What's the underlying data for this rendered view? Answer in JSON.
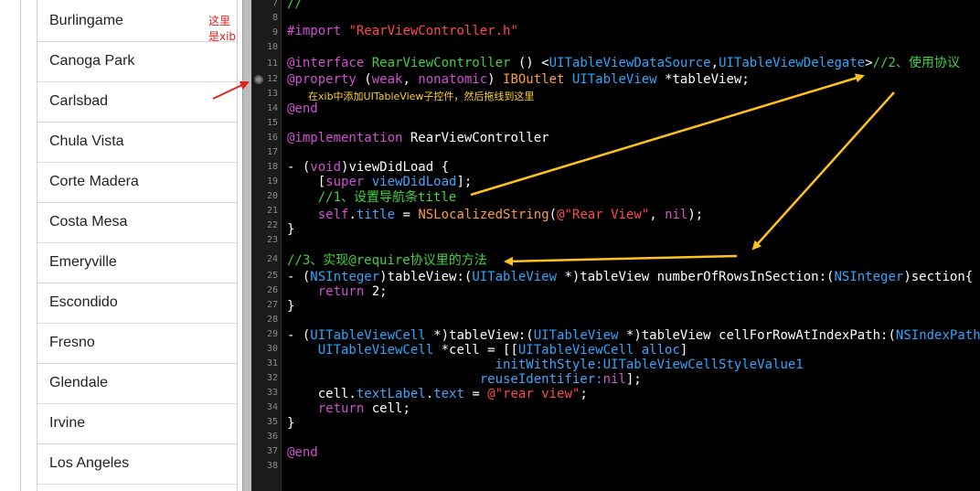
{
  "simulator": {
    "cities": [
      "Burlingame",
      "Canoga Park",
      "Carlsbad",
      "Chula Vista",
      "Corte Madera",
      "Costa Mesa",
      "Emeryville",
      "Escondido",
      "Fresno",
      "Glendale",
      "Irvine",
      "Los Angeles"
    ],
    "xib_note": "这里是xib"
  },
  "editor": {
    "line_numbers": [
      "7",
      "8",
      "9",
      "10",
      "11",
      "12",
      "13",
      "14",
      "15",
      "16",
      "17",
      "18",
      "19",
      "20",
      "21",
      "22",
      "23",
      "24",
      "25",
      "26",
      "27",
      "28",
      "29",
      "30",
      "31",
      "32",
      "33",
      "34",
      "35",
      "36",
      "37",
      "38"
    ],
    "code": {
      "l7": "//",
      "l9_import": "#import",
      "l9_file": "\"RearViewController.h\"",
      "l11_interface": "@interface",
      "l11_class": "RearViewController",
      "l11_paren": " () <",
      "l11_proto1": "UITableViewDataSource",
      "l11_comma": ",",
      "l11_proto2": "UITableViewDelegate",
      "l11_gt": ">",
      "l11_comment": "//2、使用协议",
      "l12_property": "@property",
      "l12_open": " (",
      "l12_weak": "weak",
      "l12_sep": ", ",
      "l12_nonatomic": "nonatomic",
      "l12_close": ") ",
      "l12_iboutlet": "IBOutlet",
      "l12_sp": " ",
      "l12_type": "UITableView",
      "l12_var": " *tableView;",
      "l14_end": "@end",
      "l16_impl": "@implementation",
      "l16_class": " RearViewController",
      "l18_a": "- (",
      "l18_void": "void",
      "l18_b": ")viewDidLoad {",
      "l19_a": "    [",
      "l19_super": "super",
      "l19_sp": " ",
      "l19_method": "viewDidLoad",
      "l19_b": "];",
      "l20_comment": "    //1、设置导航条title",
      "l21_a": "    ",
      "l21_self": "self",
      "l21_dot": ".",
      "l21_title": "title",
      "l21_eq": " = ",
      "l21_fn": "NSLocalizedString",
      "l21_p": "(",
      "l21_str": "@\"Rear View\"",
      "l21_c": ", ",
      "l21_nil": "nil",
      "l21_end": ");",
      "l22_brace": "}",
      "l24_comment": "//3、实现@require协议里的方法",
      "l25_a": "- (",
      "l25_t1": "NSInteger",
      "l25_b": ")tableView:(",
      "l25_t2": "UITableView",
      "l25_c": " *)tableView numberOfRowsInSection:(",
      "l25_t3": "NSInteger",
      "l25_d": ")section{",
      "l26_a": "    ",
      "l26_return": "return",
      "l26_b": " 2;",
      "l27_brace": "}",
      "l29_a": "- (",
      "l29_t1": "UITableViewCell",
      "l29_b": " *)tableView:(",
      "l29_t2": "UITableView",
      "l29_c": " *)tableView cellForRowAtIndexPath:(",
      "l29_t3": "NSIndexPath",
      "l30_a": "    ",
      "l30_t1": "UITableViewCell",
      "l30_b": " *cell = [[",
      "l30_t2": "UITableViewCell",
      "l30_sp": " ",
      "l30_alloc": "alloc",
      "l30_end": "]",
      "l31_a": "                           ",
      "l31_m": "initWithStyle:",
      "l31_v": "UITableViewCellStyleValue1",
      "l32_a": "                         ",
      "l32_m": "reuseIdentifier:",
      "l32_nil": "nil",
      "l32_end": "];",
      "l33_a": "    ",
      "l33_cell": "cell.",
      "l33_tl": "textLabel",
      "l33_dot": ".",
      "l33_text": "text",
      "l33_eq": " = ",
      "l33_str": "@\"rear view\"",
      "l33_end": ";",
      "l34_a": "    ",
      "l34_return": "return",
      "l34_b": " cell;",
      "l35_brace": "}",
      "l37_end": "@end"
    },
    "annotation_xib": "在xib中添加UITableView子控件，然后拖线到这里"
  },
  "colors": {
    "arrow_yellow": "#ffc21a",
    "arrow_red": "#e8201a",
    "keyword": "#d24fd3",
    "string": "#ff4a4a",
    "type": "#2aa8ff",
    "comment": "#41d141"
  }
}
